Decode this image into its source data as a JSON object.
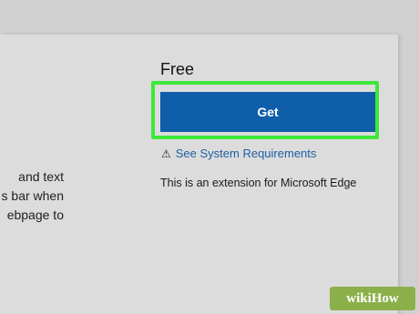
{
  "listing": {
    "description_lines": [
      "and text",
      "s bar when",
      "ebpage to"
    ],
    "price": "Free",
    "get_button": "Get",
    "system_requirements": "See System Requirements",
    "extension_note": "This is an extension for Microsoft Edge"
  },
  "icons": {
    "warning": "warning-triangle-icon"
  },
  "colors": {
    "button_bg": "#0f5ea9",
    "highlight": "#3ee83a",
    "link": "#1f5fa4"
  },
  "watermark": "wikiHow"
}
